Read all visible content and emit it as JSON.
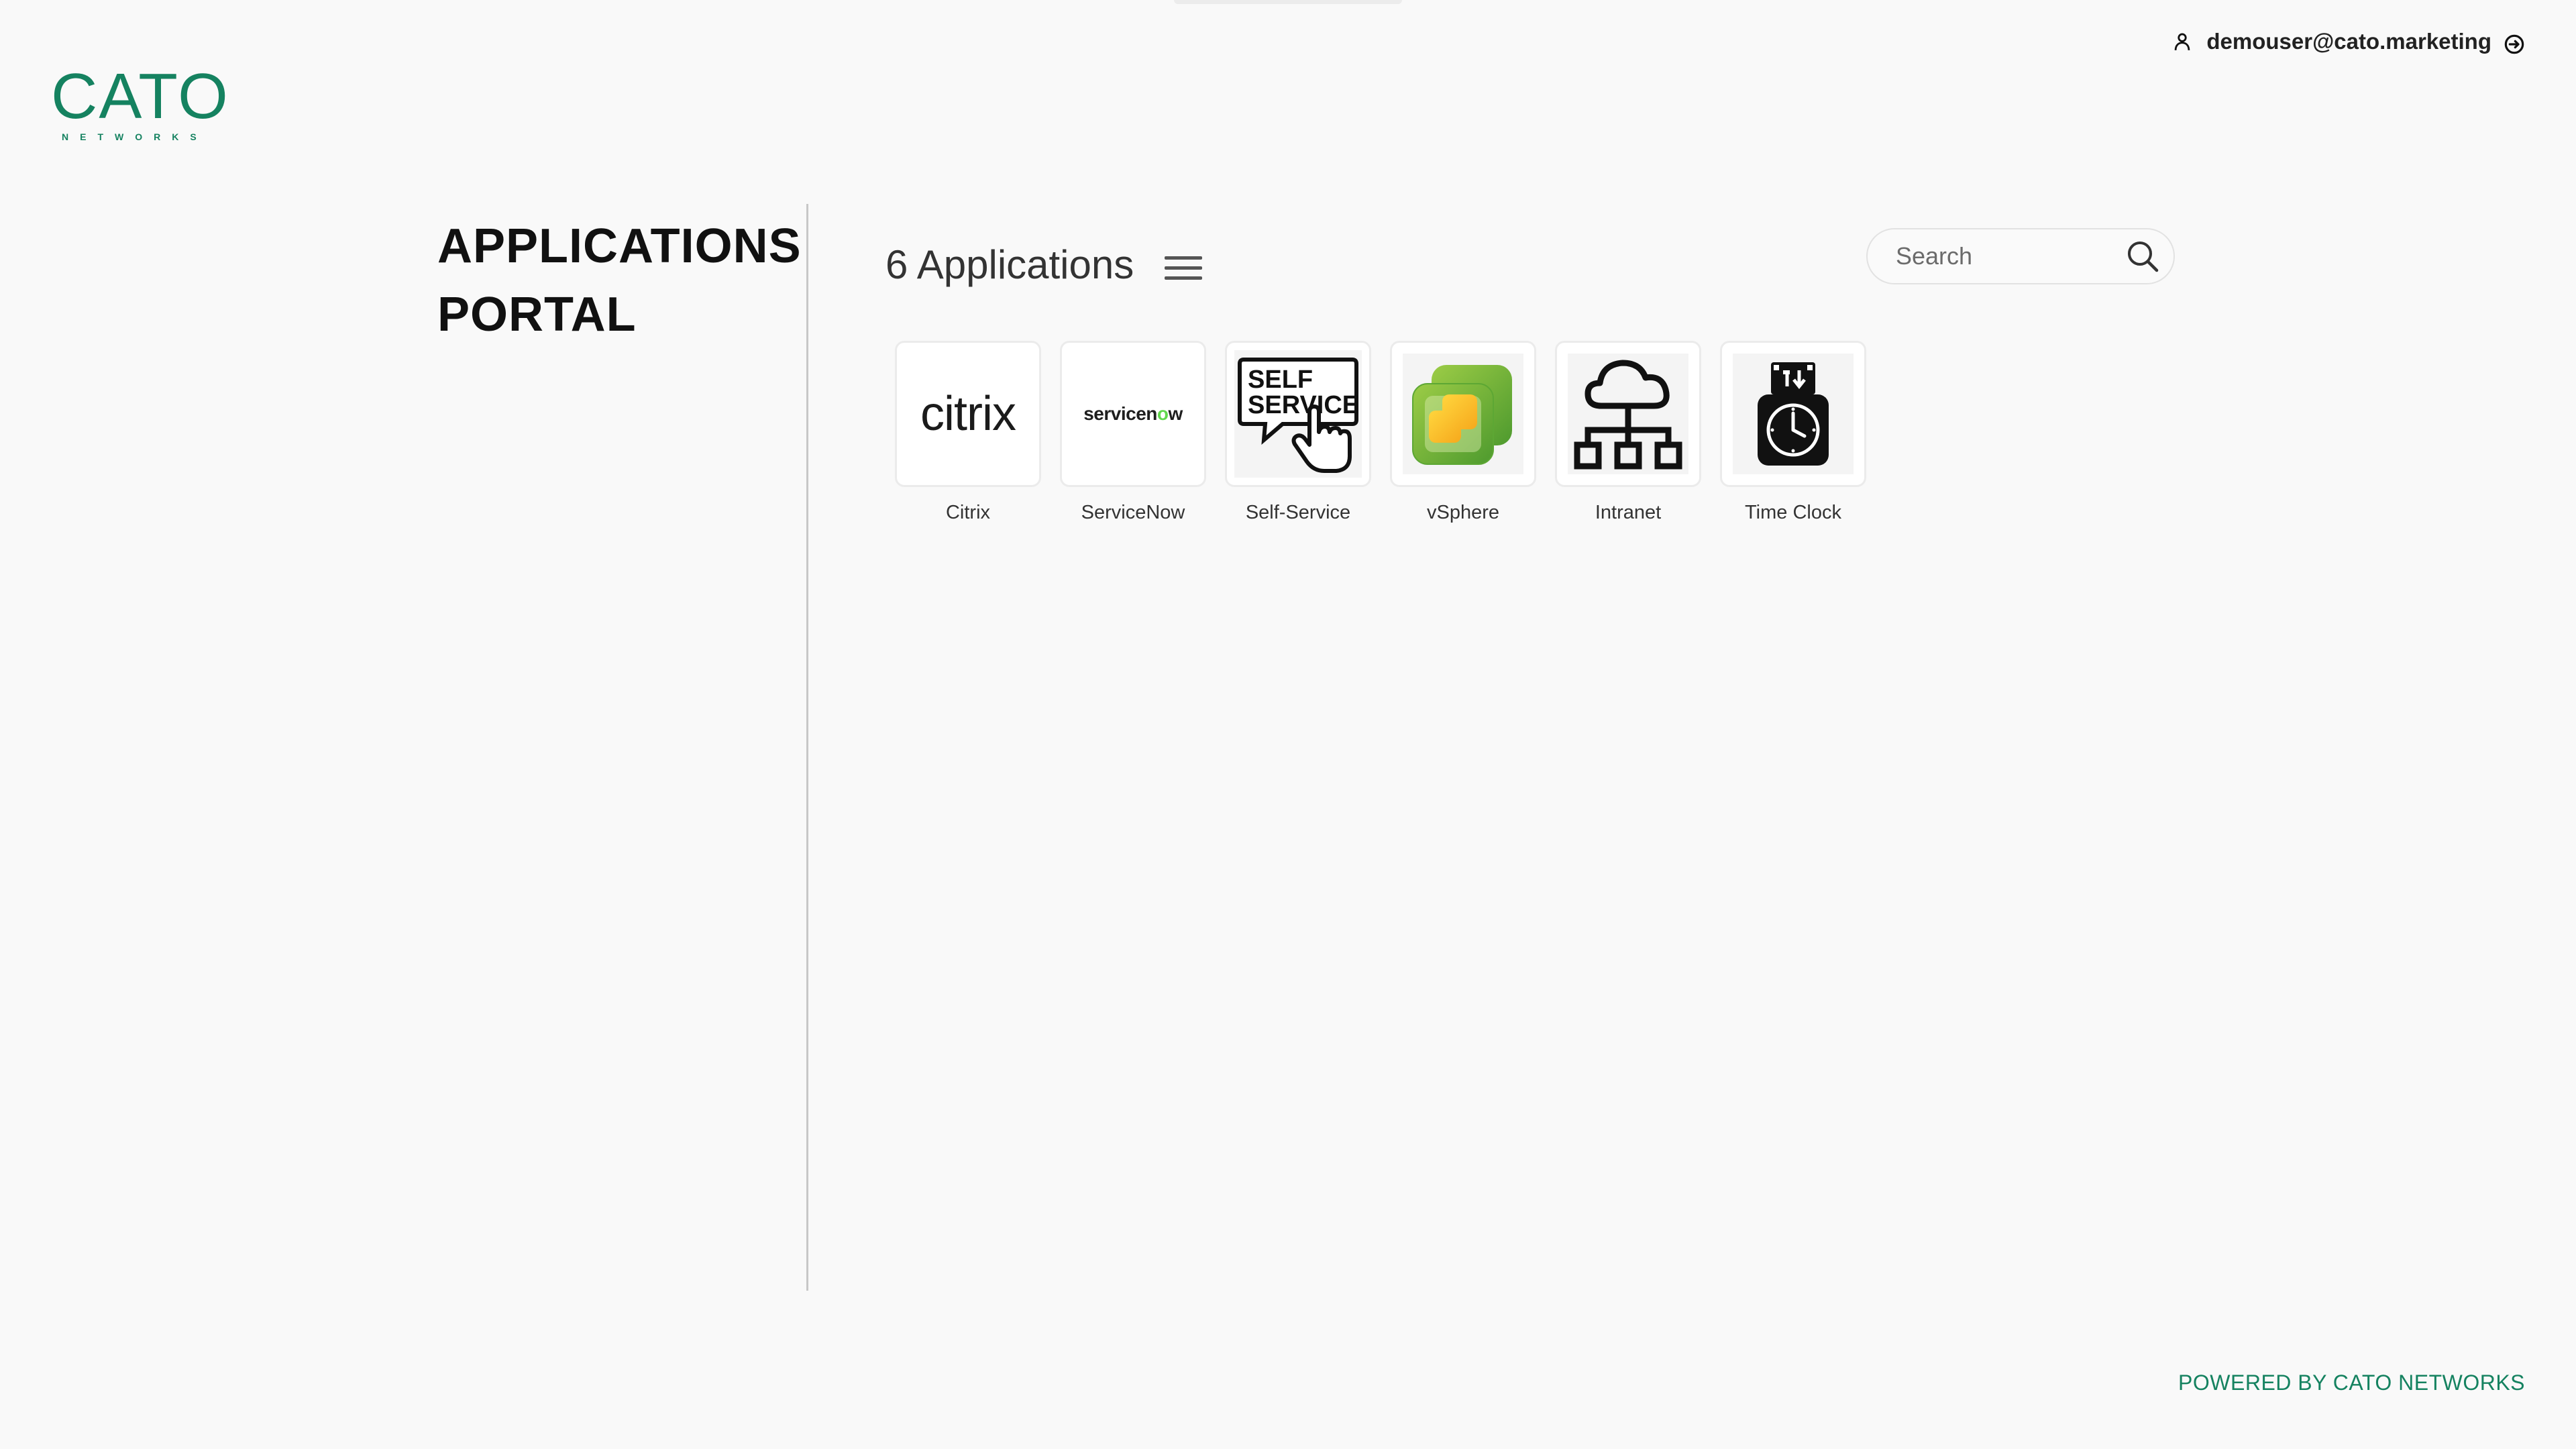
{
  "brand": {
    "logo_text": "CATO",
    "logo_subtext": "NETWORKS",
    "color": "#158260"
  },
  "user": {
    "email": "demouser@cato.marketing",
    "user_icon": "user-icon",
    "logout_icon": "logout-icon"
  },
  "sidebar": {
    "title": "APPLICATIONS\nPORTAL"
  },
  "content": {
    "count_label": "6 Applications",
    "menu_icon": "hamburger-menu-icon",
    "search": {
      "placeholder": "Search",
      "value": "",
      "icon": "search-icon"
    },
    "apps": [
      {
        "label": "Citrix",
        "logo_text": "citrix"
      },
      {
        "label": "ServiceNow",
        "logo_text_a": "servicen",
        "logo_text_o": "o",
        "logo_text_b": "w"
      },
      {
        "label": "Self-Service",
        "logo_line1": "SELF",
        "logo_line2": "SERVICE"
      },
      {
        "label": "vSphere",
        "icon": "vsphere-icon"
      },
      {
        "label": "Intranet",
        "icon": "network-cloud-icon"
      },
      {
        "label": "Time Clock",
        "icon": "time-clock-icon"
      }
    ]
  },
  "footer": {
    "text": "POWERED BY CATO NETWORKS"
  }
}
